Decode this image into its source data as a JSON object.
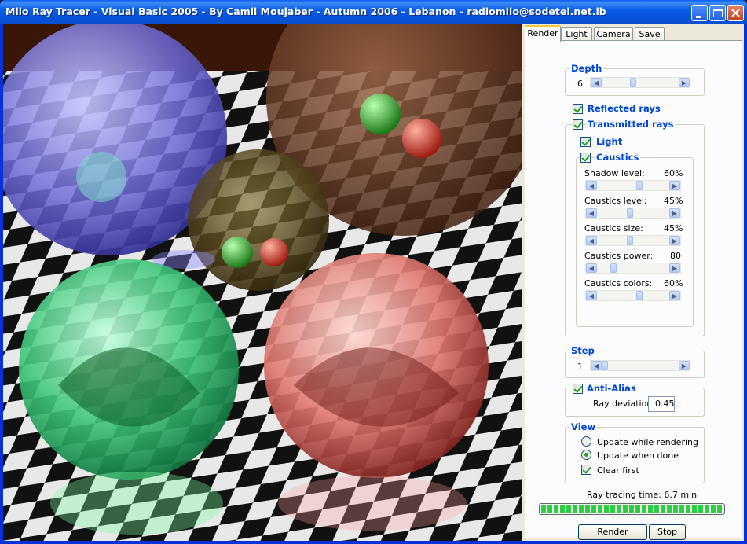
{
  "window": {
    "title": "Milo Ray Tracer - Visual Basic 2005 - By Camil Moujaber - Autumn 2006 - Lebanon - radiomilo@sodetel.net.lb"
  },
  "tabs": [
    {
      "label": "Render",
      "active": true
    },
    {
      "label": "Light",
      "active": false
    },
    {
      "label": "Camera",
      "active": false
    },
    {
      "label": "Save",
      "active": false
    }
  ],
  "render": {
    "depth": {
      "label": "Depth",
      "value": "6",
      "level": 0.4
    },
    "reflected_rays": {
      "label": "Reflected rays",
      "checked": true
    },
    "transmitted_rays": {
      "label": "Transmitted rays",
      "checked": true
    },
    "light": {
      "label": "Light",
      "checked": true
    },
    "caustics": {
      "label": "Caustics",
      "checked": true,
      "sliders": [
        {
          "label": "Shadow level:",
          "value": "60%",
          "level": 0.6
        },
        {
          "label": "Caustics level:",
          "value": "45%",
          "level": 0.45
        },
        {
          "label": "Caustics size:",
          "value": "45%",
          "level": 0.45
        },
        {
          "label": "Caustics power:",
          "value": "80",
          "level": 0.2
        },
        {
          "label": "Caustics colors:",
          "value": "60%",
          "level": 0.6
        }
      ]
    },
    "step": {
      "label": "Step",
      "value": "1",
      "level": 0.0
    },
    "anti_alias": {
      "label": "Anti-Alias",
      "checked": true,
      "deviation_label": "Ray deviation:",
      "deviation_value": "0.45"
    },
    "view": {
      "label": "View",
      "options": [
        {
          "label": "Update while rendering",
          "selected": false
        },
        {
          "label": "Update when done",
          "selected": true
        }
      ],
      "clear_first": {
        "label": "Clear first",
        "checked": true
      }
    },
    "time_label": "Ray tracing time: 6.7 min",
    "progress": 1.0,
    "render_button": "Render",
    "stop_button": "Stop"
  },
  "colors": {
    "titlebar": "#0b5fe8",
    "group_label": "#0046d5",
    "progress": "#28d23c"
  }
}
